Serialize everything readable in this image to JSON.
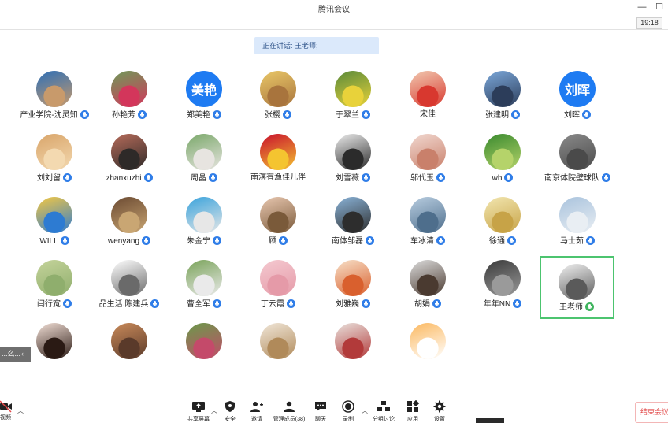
{
  "window": {
    "title": "腾讯会议",
    "min_symbol": "—",
    "max_symbol": "☐",
    "clock": "19:18"
  },
  "speaking": "正在讲话: 王老师;",
  "participants": [
    {
      "name": "产业学院-沈灵知",
      "avatar": "photo",
      "bg": [
        "#2e6fb6",
        "#c89a6b"
      ],
      "mic": true
    },
    {
      "name": "孙艳芳",
      "avatar": "photo",
      "bg": [
        "#6f9a5a",
        "#d3365b"
      ],
      "mic": true
    },
    {
      "name": "郑美艳",
      "avatar": "text",
      "avatar_text": "美艳",
      "mic": true
    },
    {
      "name": "张樱",
      "avatar": "photo",
      "bg": [
        "#e9c768",
        "#a8743d"
      ],
      "mic": true
    },
    {
      "name": "于翠兰",
      "avatar": "photo",
      "bg": [
        "#5a8a3a",
        "#e8d23a"
      ],
      "mic": true
    },
    {
      "name": "宋佳",
      "avatar": "photo",
      "bg": [
        "#f1c9b0",
        "#d8382f"
      ],
      "mic": false
    },
    {
      "name": "张建明",
      "avatar": "photo",
      "bg": [
        "#7ba7d9",
        "#2c3d5a"
      ],
      "mic": true
    },
    {
      "name": "刘晖",
      "avatar": "text",
      "avatar_text": "刘晖",
      "mic": true
    },
    {
      "name": "刘刘留",
      "avatar": "photo",
      "bg": [
        "#d9a56a",
        "#f3d9b0"
      ],
      "mic": true
    },
    {
      "name": "zhanxuzhi",
      "avatar": "photo",
      "bg": [
        "#b66b5a",
        "#2e2a28"
      ],
      "mic": true
    },
    {
      "name": "周晶",
      "avatar": "photo",
      "bg": [
        "#7aa86a",
        "#e7e4e0"
      ],
      "mic": true
    },
    {
      "name": "南溟有渔佳儿伴",
      "avatar": "photo",
      "bg": [
        "#c8102e",
        "#f4c430"
      ],
      "mic": false
    },
    {
      "name": "刘雪薇",
      "avatar": "photo",
      "bg": [
        "#ececec",
        "#2b2b2b"
      ],
      "mic": true
    },
    {
      "name": "邬代玉",
      "avatar": "photo",
      "bg": [
        "#f1d8d0",
        "#c9806b"
      ],
      "mic": true
    },
    {
      "name": "wh",
      "avatar": "photo",
      "bg": [
        "#3a8a2f",
        "#b5d36a"
      ],
      "mic": true
    },
    {
      "name": "南京体院壁球队",
      "avatar": "photo",
      "bg": [
        "#8a8a8a",
        "#4a4a4a"
      ],
      "mic": true
    },
    {
      "name": "WILL",
      "avatar": "photo",
      "bg": [
        "#f4c842",
        "#2d7bd2"
      ],
      "mic": true
    },
    {
      "name": "wenyang",
      "avatar": "photo",
      "bg": [
        "#6b4a32",
        "#c9a673"
      ],
      "mic": true
    },
    {
      "name": "朱金宁",
      "avatar": "photo",
      "bg": [
        "#3aa3dc",
        "#e7e7e7"
      ],
      "mic": true
    },
    {
      "name": "顾",
      "avatar": "photo",
      "bg": [
        "#e8c7b0",
        "#7a5a3a"
      ],
      "mic": true
    },
    {
      "name": "南体邹磊",
      "avatar": "photo",
      "bg": [
        "#8ab3d8",
        "#2d2d2d"
      ],
      "mic": true
    },
    {
      "name": "车冰清",
      "avatar": "photo",
      "bg": [
        "#b8cde0",
        "#4e6e8c"
      ],
      "mic": true
    },
    {
      "name": "徐通",
      "avatar": "photo",
      "bg": [
        "#f2e6b0",
        "#c7a347"
      ],
      "mic": true
    },
    {
      "name": "马士茹",
      "avatar": "photo",
      "bg": [
        "#a9c3dd",
        "#e9eef3"
      ],
      "mic": true
    },
    {
      "name": "闫行宽",
      "avatar": "photo",
      "bg": [
        "#c4d39a",
        "#8fae6d"
      ],
      "mic": true
    },
    {
      "name": "品生活.陈建兵",
      "avatar": "photo",
      "bg": [
        "#ffffff",
        "#6a6a6a"
      ],
      "mic": true
    },
    {
      "name": "曹全军",
      "avatar": "photo",
      "bg": [
        "#7aa35a",
        "#eaeaea"
      ],
      "mic": true
    },
    {
      "name": "丁云霞",
      "avatar": "photo",
      "bg": [
        "#f4c9d0",
        "#e59aa8"
      ],
      "mic": true
    },
    {
      "name": "刘雅巍",
      "avatar": "photo",
      "bg": [
        "#f7e0c8",
        "#d9602e"
      ],
      "mic": true
    },
    {
      "name": "胡娟",
      "avatar": "photo",
      "bg": [
        "#dcdcdc",
        "#4a3a30"
      ],
      "mic": true
    },
    {
      "name": "年年NN",
      "avatar": "photo",
      "bg": [
        "#3a3a3a",
        "#9a9a9a"
      ],
      "mic": true
    },
    {
      "name": "王老师",
      "avatar": "photo",
      "bg": [
        "#f0f0f0",
        "#5a5a5a"
      ],
      "mic": true,
      "selected": true
    },
    {
      "name": "",
      "avatar": "photo",
      "bg": [
        "#f2dfd6",
        "#2a1a14"
      ],
      "mic": false
    },
    {
      "name": "",
      "avatar": "photo",
      "bg": [
        "#c98a5a",
        "#5a3a2a"
      ],
      "mic": false
    },
    {
      "name": "",
      "avatar": "photo",
      "bg": [
        "#6a9a4a",
        "#c44a6a"
      ],
      "mic": false
    },
    {
      "name": "",
      "avatar": "photo",
      "bg": [
        "#f0e6d8",
        "#b08a5a"
      ],
      "mic": false
    },
    {
      "name": "",
      "avatar": "photo",
      "bg": [
        "#e9e1dc",
        "#b23a3a"
      ],
      "mic": false
    },
    {
      "name": "",
      "avatar": "photo",
      "bg": [
        "#fbb860",
        "#ffffff"
      ],
      "mic": false
    }
  ],
  "side_panel": {
    "label": "...么...",
    "chevron": "‹"
  },
  "toolbar": {
    "video_label": "视频",
    "items": [
      {
        "id": "share",
        "label": "共享屏幕"
      },
      {
        "id": "security",
        "label": "安全"
      },
      {
        "id": "invite",
        "label": "邀请"
      },
      {
        "id": "members",
        "label": "管理成员(38)"
      },
      {
        "id": "chat",
        "label": "聊天"
      },
      {
        "id": "record",
        "label": "录制"
      },
      {
        "id": "breakout",
        "label": "分组讨论"
      },
      {
        "id": "apps",
        "label": "应用"
      },
      {
        "id": "settings",
        "label": "设置"
      }
    ],
    "end_label": "结束会议"
  },
  "colors": {
    "accent_blue": "#1e7bf2",
    "selected_border": "#4cc46f",
    "end_red": "#e24848"
  }
}
